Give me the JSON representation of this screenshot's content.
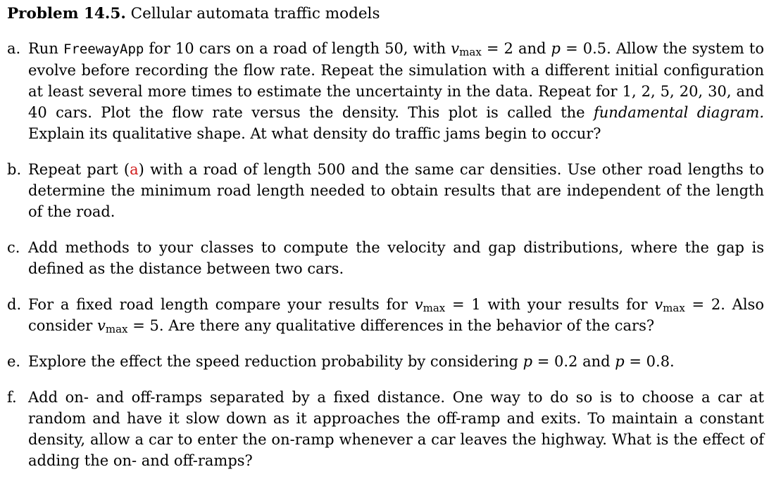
{
  "header": {
    "problem_number": "Problem 14.5.",
    "problem_title": "Cellular automata traffic models"
  },
  "parts": {
    "a": {
      "marker": "a.",
      "t1": "Run ",
      "code": "FreewayApp",
      "t2": " for 10 cars on a road of length 50, with ",
      "v": "v",
      "sub_max": "max",
      "t3": " = 2 and ",
      "p": "p",
      "t4": " = 0.5. Allow the system to evolve before recording the flow rate. Repeat the simulation with a different initial configuration at least several more times to estimate the uncertainty in the data. Repeat for 1, 2, 5, 20, 30, and 40 cars. Plot the flow rate versus the density. This plot is called the ",
      "em": "fundamental diagram.",
      "t5": " Explain its qualitative shape. At what density do traffic jams begin to occur?"
    },
    "b": {
      "marker": "b.",
      "t1": "Repeat part (",
      "ref": "a",
      "t2": ") with a road of length 500 and the same car densities. Use other road lengths to determine the minimum road length needed to obtain results that are independent of the length of the road."
    },
    "c": {
      "marker": "c.",
      "text": "Add methods to your classes to compute the velocity and gap distributions, where the gap is defined as the distance between two cars."
    },
    "d": {
      "marker": "d.",
      "t1": "For a fixed road length compare your results for ",
      "v": "v",
      "sub_max": "max",
      "t2": " = 1 with your results for ",
      "t3": " = 2. Also consider ",
      "t4": " = 5. Are there any qualitative differences in the behavior of the cars?"
    },
    "e": {
      "marker": "e.",
      "t1": "Explore the effect the speed reduction probability by considering ",
      "p": "p",
      "t2": " = 0.2 and ",
      "t3": " = 0.8."
    },
    "f": {
      "marker": "f.",
      "text": "Add on- and off-ramps separated by a fixed distance. One way to do so is to choose a car at random and have it slow down as it approaches the off-ramp and exits. To maintain a constant density, allow a car to enter the on-ramp whenever a car leaves the highway. What is the effect of adding the on- and off-ramps?"
    }
  },
  "colors": {
    "text": "#000000",
    "cross_reference": "#d01c1c",
    "background": "#ffffff"
  }
}
